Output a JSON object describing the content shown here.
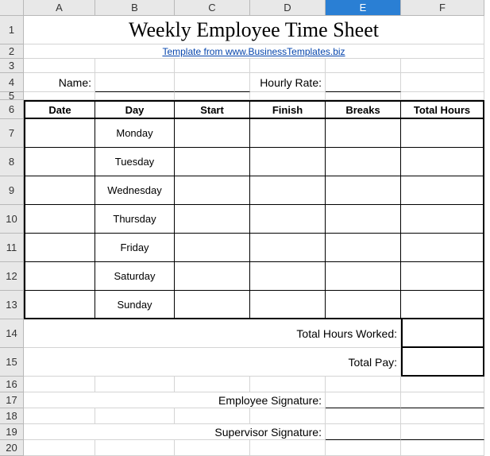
{
  "columns": [
    "A",
    "B",
    "C",
    "D",
    "E",
    "F"
  ],
  "active_column": "E",
  "rows": [
    "1",
    "2",
    "3",
    "4",
    "5",
    "6",
    "7",
    "8",
    "9",
    "10",
    "11",
    "12",
    "13",
    "14",
    "15",
    "16",
    "17",
    "18",
    "19",
    "20"
  ],
  "title": "Weekly Employee Time Sheet",
  "link_text": "Template from www.BusinessTemplates.biz",
  "labels": {
    "name": "Name:",
    "hourly_rate": "Hourly Rate:",
    "total_hours_worked": "Total Hours Worked:",
    "total_pay": "Total Pay:",
    "employee_signature": "Employee Signature:",
    "supervisor_signature": "Supervisor Signature:"
  },
  "table": {
    "headers": [
      "Date",
      "Day",
      "Start",
      "Finish",
      "Breaks",
      "Total Hours"
    ],
    "days": [
      "Monday",
      "Tuesday",
      "Wednesday",
      "Thursday",
      "Friday",
      "Saturday",
      "Sunday"
    ]
  }
}
